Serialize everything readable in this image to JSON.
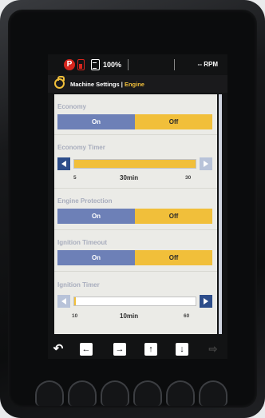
{
  "status": {
    "parking_icon": "P",
    "battery_percent": "100%",
    "rpm": "-- RPM"
  },
  "header": {
    "title_prefix": "Machine Settings |",
    "title_current": "Engine"
  },
  "settings": {
    "economy": {
      "label": "Economy",
      "on_label": "On",
      "off_label": "Off",
      "selected": "Off"
    },
    "economy_timer": {
      "label": "Economy Timer",
      "min": "5",
      "max": "30",
      "value_label": "30min",
      "value": 30,
      "range": [
        5,
        30
      ]
    },
    "engine_protection": {
      "label": "Engine Protection",
      "on_label": "On",
      "off_label": "Off",
      "selected": "Off"
    },
    "ignition_timeout": {
      "label": "Ignition Timeout",
      "on_label": "On",
      "off_label": "Off",
      "selected": "Off"
    },
    "ignition_timer": {
      "label": "Ignition Timer",
      "min": "10",
      "max": "60",
      "value_label": "10min",
      "value": 10,
      "range": [
        10,
        60
      ]
    }
  },
  "nav": {
    "back_icon": "back-icon",
    "left_icon": "arrow-left-icon",
    "right_icon": "arrow-right-icon",
    "up_icon": "arrow-up-icon",
    "down_icon": "arrow-down-icon",
    "exit_icon": "exit-icon"
  },
  "colors": {
    "accent": "#f1bf3a",
    "on_state": "#6d80b7",
    "button": "#2d4d8a",
    "alert": "#d7261d"
  }
}
